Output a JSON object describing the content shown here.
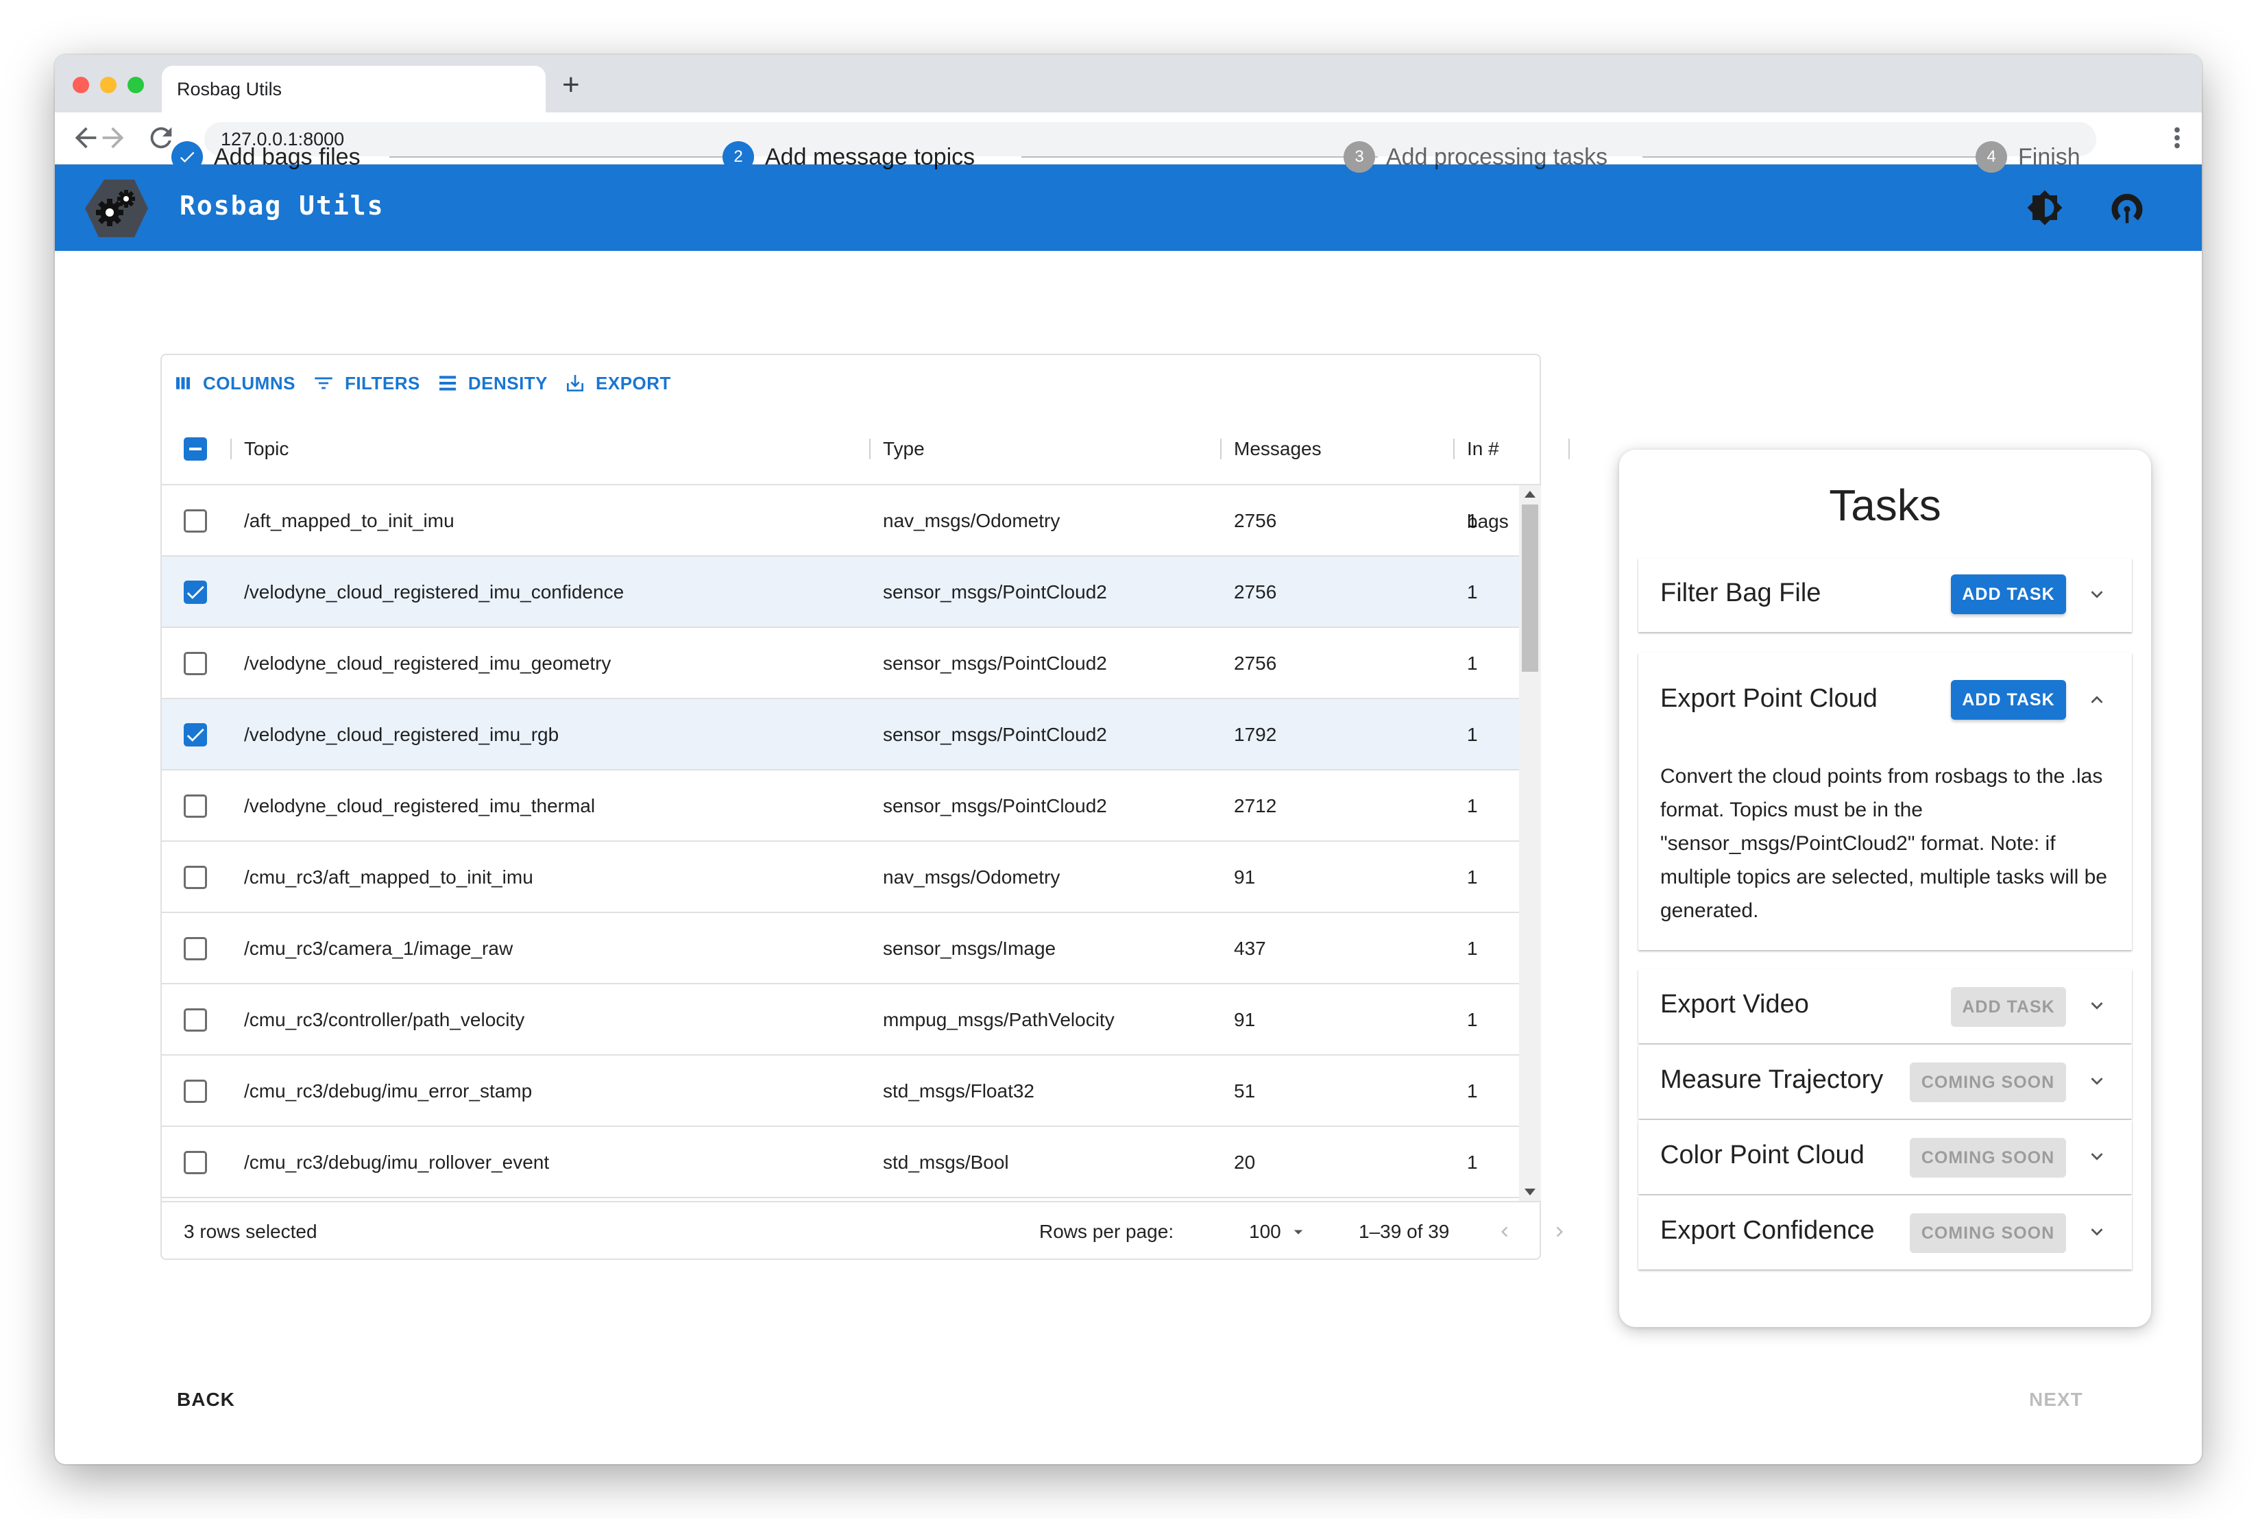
{
  "browser": {
    "tab_title": "Rosbag Utils",
    "new_tab": "+",
    "url": "127.0.0.1:8000"
  },
  "app": {
    "title": "Rosbag Utils",
    "brand_color": "#1976d2",
    "icons": [
      "settings-gears-icon",
      "theme-brightness-icon",
      "broadcast-icon"
    ]
  },
  "stepper": {
    "steps": [
      {
        "label": "Add bags files",
        "state": "completed",
        "number": ""
      },
      {
        "label": "Add message topics",
        "state": "active",
        "number": "2"
      },
      {
        "label": "Add processing tasks",
        "state": "pending",
        "number": "3"
      },
      {
        "label": "Finish",
        "state": "pending",
        "number": "4"
      }
    ]
  },
  "grid": {
    "toolbar": {
      "columns": "COLUMNS",
      "filters": "FILTERS",
      "density": "DENSITY",
      "export": "EXPORT"
    },
    "headers": {
      "topic": "Topic",
      "type": "Type",
      "messages": "Messages",
      "bags": "In # bags"
    },
    "rows": [
      {
        "topic": "/aft_mapped_to_init_imu",
        "type": "nav_msgs/Odometry",
        "messages": "2756",
        "bags": "1",
        "checked": false
      },
      {
        "topic": "/velodyne_cloud_registered_imu_confidence",
        "type": "sensor_msgs/PointCloud2",
        "messages": "2756",
        "bags": "1",
        "checked": true
      },
      {
        "topic": "/velodyne_cloud_registered_imu_geometry",
        "type": "sensor_msgs/PointCloud2",
        "messages": "2756",
        "bags": "1",
        "checked": false
      },
      {
        "topic": "/velodyne_cloud_registered_imu_rgb",
        "type": "sensor_msgs/PointCloud2",
        "messages": "1792",
        "bags": "1",
        "checked": true
      },
      {
        "topic": "/velodyne_cloud_registered_imu_thermal",
        "type": "sensor_msgs/PointCloud2",
        "messages": "2712",
        "bags": "1",
        "checked": false
      },
      {
        "topic": "/cmu_rc3/aft_mapped_to_init_imu",
        "type": "nav_msgs/Odometry",
        "messages": "91",
        "bags": "1",
        "checked": false
      },
      {
        "topic": "/cmu_rc3/camera_1/image_raw",
        "type": "sensor_msgs/Image",
        "messages": "437",
        "bags": "1",
        "checked": false
      },
      {
        "topic": "/cmu_rc3/controller/path_velocity",
        "type": "mmpug_msgs/PathVelocity",
        "messages": "91",
        "bags": "1",
        "checked": false
      },
      {
        "topic": "/cmu_rc3/debug/imu_error_stamp",
        "type": "std_msgs/Float32",
        "messages": "51",
        "bags": "1",
        "checked": false
      },
      {
        "topic": "/cmu_rc3/debug/imu_rollover_event",
        "type": "std_msgs/Bool",
        "messages": "20",
        "bags": "1",
        "checked": false
      }
    ],
    "footer": {
      "selected_text": "3 rows selected",
      "rows_per_page_label": "Rows per page:",
      "rows_per_page_value": "100",
      "range_text": "1–39 of 39"
    }
  },
  "tasks": {
    "title": "Tasks",
    "items": [
      {
        "label": "Filter Bag File",
        "button": "ADD TASK",
        "button_state": "enabled",
        "expanded": false
      },
      {
        "label": "Export Point Cloud",
        "button": "ADD TASK",
        "button_state": "enabled",
        "expanded": true,
        "description": "Convert the cloud points from rosbags to the .las format. Topics must be in the \"sensor_msgs/PointCloud2\" format. Note: if multiple topics are selected, multiple tasks will be generated."
      },
      {
        "label": "Export Video",
        "button": "ADD TASK",
        "button_state": "disabled",
        "expanded": false
      },
      {
        "label": "Measure Trajectory",
        "button": "COMING SOON",
        "button_state": "disabled",
        "expanded": false
      },
      {
        "label": "Color Point Cloud",
        "button": "COMING SOON",
        "button_state": "disabled",
        "expanded": false
      },
      {
        "label": "Export Confidence",
        "button": "COMING SOON",
        "button_state": "disabled",
        "expanded": false
      }
    ]
  },
  "navigation": {
    "back": "BACK",
    "next": "NEXT"
  }
}
